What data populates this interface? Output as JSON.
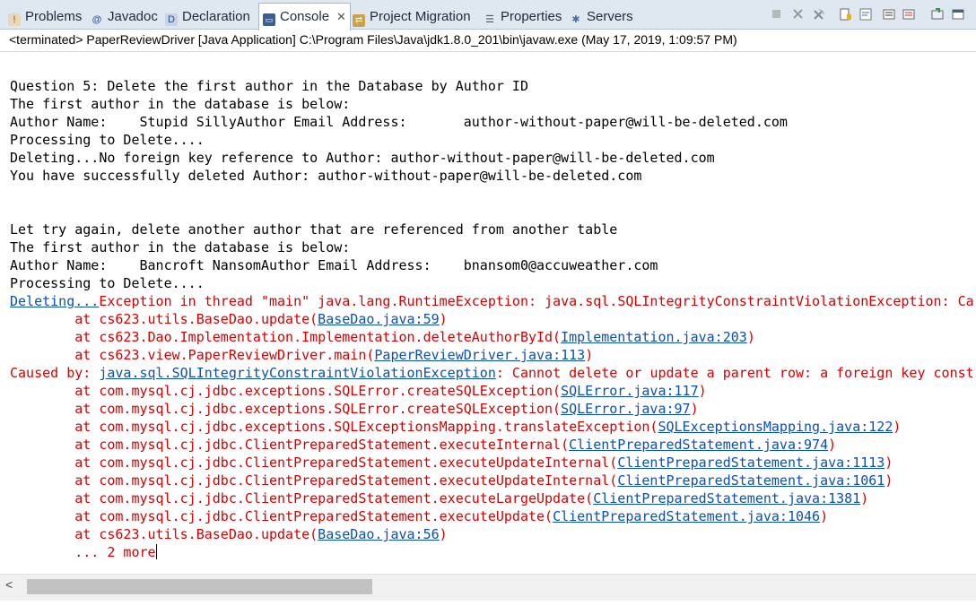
{
  "tabs": [
    {
      "label": "Problems",
      "icon": "problems-icon"
    },
    {
      "label": "Javadoc",
      "icon": "javadoc-icon"
    },
    {
      "label": "Declaration",
      "icon": "declaration-icon"
    },
    {
      "label": "Console",
      "icon": "console-icon",
      "active": true
    },
    {
      "label": "Project Migration",
      "icon": "project-migration-icon"
    },
    {
      "label": "Properties",
      "icon": "properties-icon"
    },
    {
      "label": "Servers",
      "icon": "servers-icon"
    }
  ],
  "status": "<terminated> PaperReviewDriver [Java Application] C:\\Program Files\\Java\\jdk1.8.0_201\\bin\\javaw.exe (May 17, 2019, 1:09:57 PM)",
  "console_lines": [
    [
      {
        "t": "Question 5: Delete the first author in the Database by Author ID",
        "c": "out"
      }
    ],
    [
      {
        "t": "The first author in the database is below:",
        "c": "out"
      }
    ],
    [
      {
        "t": "Author Name:    Stupid SillyAuthor Email Address:       author-without-paper@will-be-deleted.com",
        "c": "out"
      }
    ],
    [
      {
        "t": "Processing to Delete....",
        "c": "out"
      }
    ],
    [
      {
        "t": "Deleting...No foreign key reference to Author: author-without-paper@will-be-deleted.com",
        "c": "out"
      }
    ],
    [
      {
        "t": "You have successfully deleted Author: author-without-paper@will-be-deleted.com",
        "c": "out"
      }
    ],
    [],
    [],
    [
      {
        "t": "Let try again, delete another author that are referenced from another table",
        "c": "out"
      }
    ],
    [
      {
        "t": "The first author in the database is below:",
        "c": "out"
      }
    ],
    [
      {
        "t": "Author Name:    Bancroft NansomAuthor Email Address:    bnansom0@accuweather.com",
        "c": "out"
      }
    ],
    [
      {
        "t": "Processing to Delete....",
        "c": "out"
      }
    ],
    [
      {
        "t": "Deleting...",
        "c": "lnk"
      },
      {
        "t": "Exception in thread \"main\" java.lang.RuntimeException: java.sql.SQLIntegrityConstraintViolationException: Car",
        "c": "err"
      }
    ],
    [
      {
        "t": "        at cs623.utils.BaseDao.update(",
        "c": "err"
      },
      {
        "t": "BaseDao.java:59",
        "c": "lnk"
      },
      {
        "t": ")",
        "c": "err"
      }
    ],
    [
      {
        "t": "        at cs623.Dao.Implementation.Implementation.deleteAuthorById(",
        "c": "err"
      },
      {
        "t": "Implementation.java:203",
        "c": "lnk"
      },
      {
        "t": ")",
        "c": "err"
      }
    ],
    [
      {
        "t": "        at cs623.view.PaperReviewDriver.main(",
        "c": "err"
      },
      {
        "t": "PaperReviewDriver.java:113",
        "c": "lnk"
      },
      {
        "t": ")",
        "c": "err"
      }
    ],
    [
      {
        "t": "Caused by: ",
        "c": "err"
      },
      {
        "t": "java.sql.SQLIntegrityConstraintViolationException",
        "c": "lnk"
      },
      {
        "t": ": Cannot delete or update a parent row: a foreign key constr",
        "c": "err"
      }
    ],
    [
      {
        "t": "        at com.mysql.cj.jdbc.exceptions.SQLError.createSQLException(",
        "c": "err"
      },
      {
        "t": "SQLError.java:117",
        "c": "lnk"
      },
      {
        "t": ")",
        "c": "err"
      }
    ],
    [
      {
        "t": "        at com.mysql.cj.jdbc.exceptions.SQLError.createSQLException(",
        "c": "err"
      },
      {
        "t": "SQLError.java:97",
        "c": "lnk"
      },
      {
        "t": ")",
        "c": "err"
      }
    ],
    [
      {
        "t": "        at com.mysql.cj.jdbc.exceptions.SQLExceptionsMapping.translateException(",
        "c": "err"
      },
      {
        "t": "SQLExceptionsMapping.java:122",
        "c": "lnk"
      },
      {
        "t": ")",
        "c": "err"
      }
    ],
    [
      {
        "t": "        at com.mysql.cj.jdbc.ClientPreparedStatement.executeInternal(",
        "c": "err"
      },
      {
        "t": "ClientPreparedStatement.java:974",
        "c": "lnk"
      },
      {
        "t": ")",
        "c": "err"
      }
    ],
    [
      {
        "t": "        at com.mysql.cj.jdbc.ClientPreparedStatement.executeUpdateInternal(",
        "c": "err"
      },
      {
        "t": "ClientPreparedStatement.java:1113",
        "c": "lnk"
      },
      {
        "t": ")",
        "c": "err"
      }
    ],
    [
      {
        "t": "        at com.mysql.cj.jdbc.ClientPreparedStatement.executeUpdateInternal(",
        "c": "err"
      },
      {
        "t": "ClientPreparedStatement.java:1061",
        "c": "lnk"
      },
      {
        "t": ")",
        "c": "err"
      }
    ],
    [
      {
        "t": "        at com.mysql.cj.jdbc.ClientPreparedStatement.executeLargeUpdate(",
        "c": "err"
      },
      {
        "t": "ClientPreparedStatement.java:1381",
        "c": "lnk"
      },
      {
        "t": ")",
        "c": "err"
      }
    ],
    [
      {
        "t": "        at com.mysql.cj.jdbc.ClientPreparedStatement.executeUpdate(",
        "c": "err"
      },
      {
        "t": "ClientPreparedStatement.java:1046",
        "c": "lnk"
      },
      {
        "t": ")",
        "c": "err"
      }
    ],
    [
      {
        "t": "        at cs623.utils.BaseDao.update(",
        "c": "err"
      },
      {
        "t": "BaseDao.java:56",
        "c": "lnk"
      },
      {
        "t": ")",
        "c": "err"
      }
    ],
    [
      {
        "t": "        ... 2 more",
        "c": "err"
      }
    ]
  ],
  "colors": {
    "stdout": "#000000",
    "stderr": "#d50000",
    "link": "#0b4fb7",
    "tabbar_bg": "#dfe7f1"
  },
  "toolbar_icons": [
    "terminate-icon",
    "remove-launch-icon",
    "remove-all-terminated-icon",
    "scroll-lock-icon",
    "word-wrap-icon",
    "show-on-stdout-icon",
    "show-on-stderr-icon",
    "pin-console-icon",
    "display-console-icon",
    "new-console-icon",
    "minimize-icon",
    "maximize-icon"
  ]
}
